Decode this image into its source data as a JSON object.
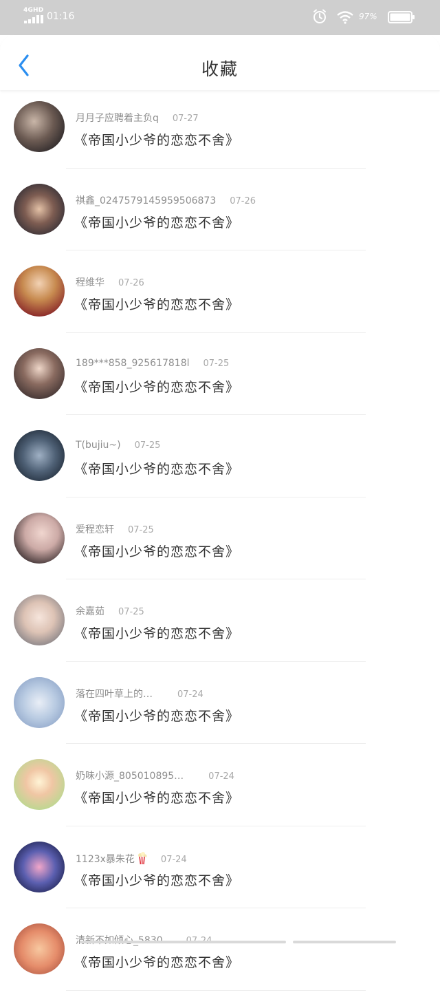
{
  "status_bar": {
    "network": "4GHD",
    "time": "01:16",
    "battery": "97%",
    "icons": [
      "signal-icon",
      "alarm-icon",
      "wifi-icon",
      "battery-icon"
    ]
  },
  "header": {
    "title": "收藏",
    "back_icon": "chevron-left-icon"
  },
  "colors": {
    "accent": "#2a8ef0",
    "status_bar_bg": "#cfcfcf"
  },
  "items": [
    {
      "user": "月月子应聘着主负q",
      "date": "07-27",
      "title": "《帝国小少爷的恋恋不舍》"
    },
    {
      "user": "祺鑫_0247579145959506873",
      "date": "07-26",
      "title": "《帝国小少爷的恋恋不舍》"
    },
    {
      "user": "程维华",
      "date": "07-26",
      "title": "《帝国小少爷的恋恋不舍》"
    },
    {
      "user": "189***858_925617818l",
      "date": "07-25",
      "title": "《帝国小少爷的恋恋不舍》"
    },
    {
      "user": "T(bujiu~)",
      "date": "07-25",
      "title": "《帝国小少爷的恋恋不舍》"
    },
    {
      "user": "爱程恋轩",
      "date": "07-25",
      "title": "《帝国小少爷的恋恋不舍》"
    },
    {
      "user": "余嘉茹",
      "date": "07-25",
      "title": "《帝国小少爷的恋恋不舍》"
    },
    {
      "user": "落在四叶草上的…",
      "date": "07-24",
      "title": "《帝国小少爷的恋恋不舍》"
    },
    {
      "user": "奶味小源_805010895…",
      "date": "07-24",
      "title": "《帝国小少爷的恋恋不舍》"
    },
    {
      "user": "1123x暴朱花",
      "date": "07-24",
      "title": "《帝国小少爷的恋恋不舍》",
      "emoji": "popcorn-icon"
    },
    {
      "user": "清新不如倾心_5830…",
      "date": "07-24",
      "title": "《帝国小少爷的恋恋不舍》"
    }
  ]
}
